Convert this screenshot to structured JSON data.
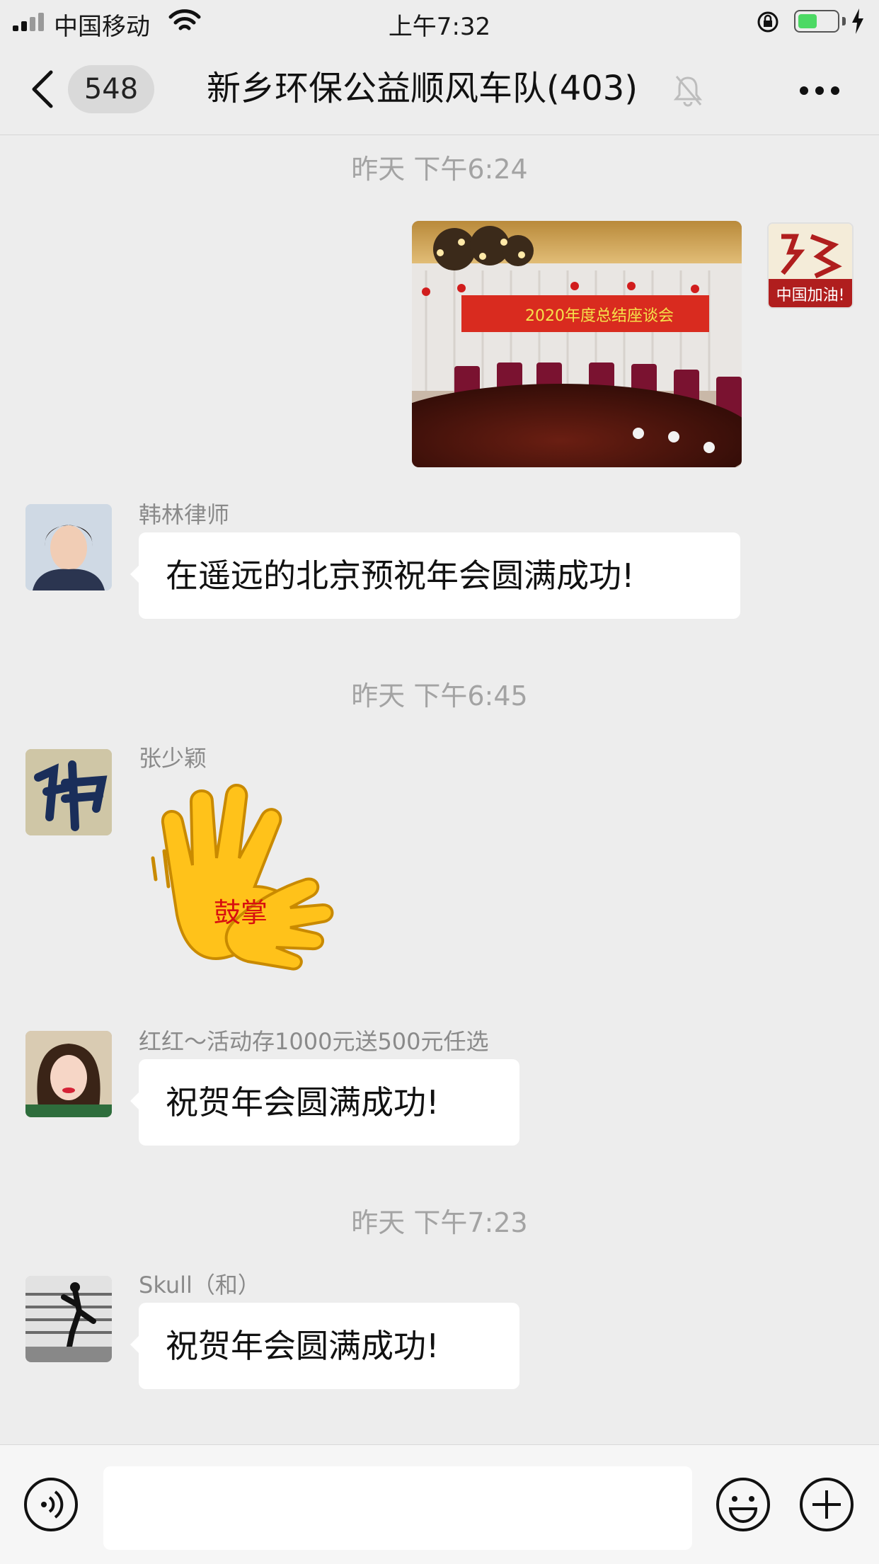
{
  "status_bar": {
    "carrier": "中国移动",
    "time": "上午7:32"
  },
  "nav": {
    "unread_count": "548",
    "chat_title": "新乡环保公益顺风车队(403)"
  },
  "messages": [
    {
      "type": "timestamp",
      "text": "昨天 下午6:24"
    },
    {
      "type": "image",
      "from": "self",
      "avatar_text": "中国加油!",
      "banner_text": "2020年度总结座谈会"
    },
    {
      "type": "text",
      "sender": "韩林律师",
      "text": "在遥远的北京预祝年会圆满成功!"
    },
    {
      "type": "timestamp",
      "text": "昨天 下午6:45"
    },
    {
      "type": "sticker",
      "sender": "张少颖",
      "sticker_text": "鼓掌"
    },
    {
      "type": "text",
      "sender": "红红～活动存1000元送500元任选",
      "text": "祝贺年会圆满成功!"
    },
    {
      "type": "timestamp",
      "text": "昨天 下午7:23"
    },
    {
      "type": "text",
      "sender": "Skull（和）",
      "text": "祝贺年会圆满成功!"
    }
  ],
  "input_bar": {
    "text_value": ""
  },
  "colors": {
    "background": "#ededed",
    "bubble": "#ffffff",
    "timestamp": "#a3a3a3",
    "battery_fill": "#4cd964"
  }
}
